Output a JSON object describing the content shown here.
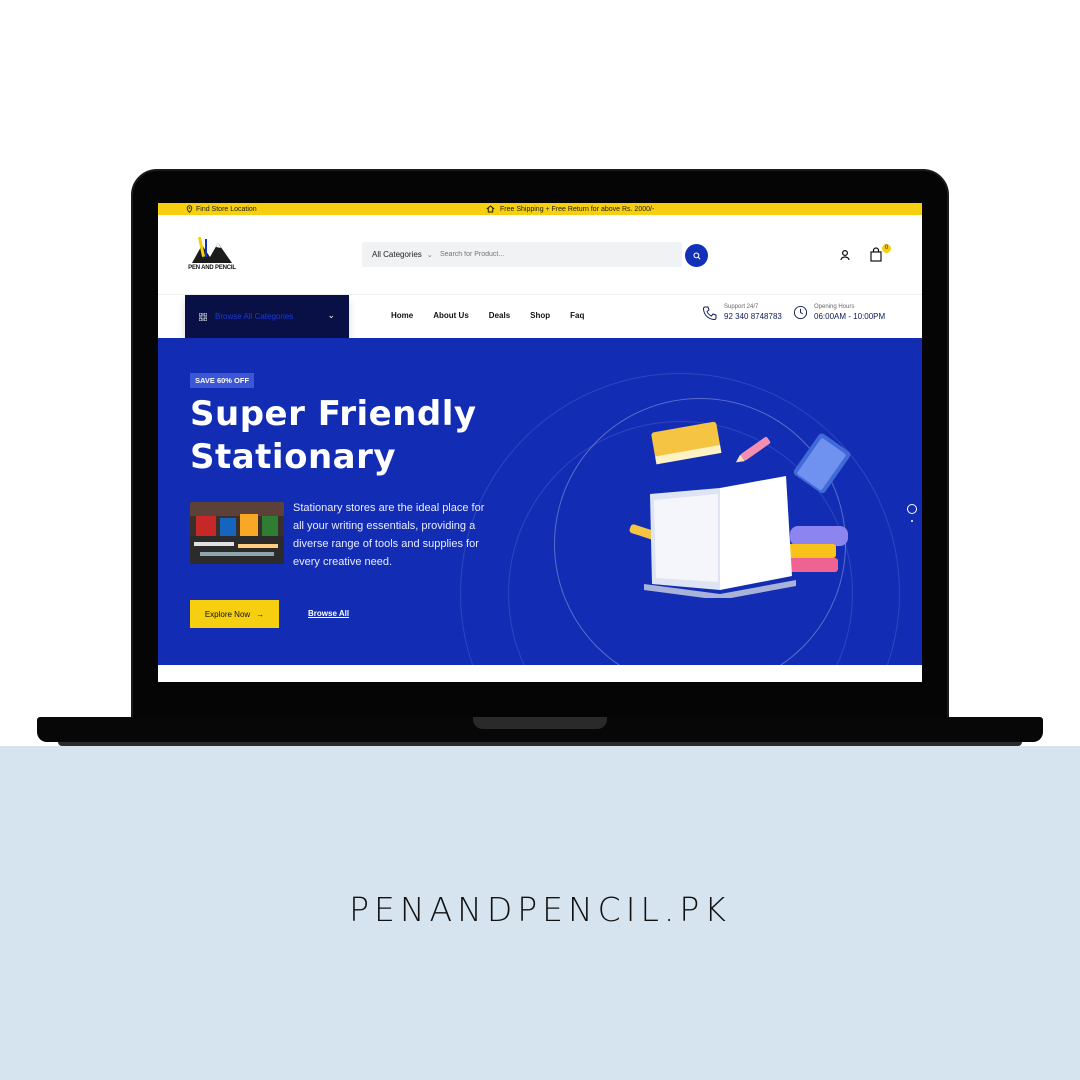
{
  "topbar": {
    "store_location": "Find Store Location",
    "promo": "Free Shipping + Free Return for above Rs. 2000/-"
  },
  "header": {
    "logo_text": "PEN AND PENCIL",
    "category_select": "All Categories",
    "search_placeholder": "Search for Product...",
    "cart_count": "0"
  },
  "nav": {
    "browse_categories": "Browse All Categories",
    "links": [
      "Home",
      "About Us",
      "Deals",
      "Shop",
      "Faq"
    ],
    "support_label": "Support 24/7",
    "support_phone": "92 340 8748783",
    "hours_label": "Opening Hours",
    "hours_value": "06:00AM - 10:00PM"
  },
  "hero": {
    "badge": "SAVE 60% OFF",
    "title": "Super Friendly Stationary",
    "description": "Stationary stores are the ideal place for all your writing essentials, providing a diverse range of tools and supplies for every creative need.",
    "explore_button": "Explore Now",
    "browse_link": "Browse All"
  },
  "footer_domain": "PENANDPENCIL.PK",
  "colors": {
    "accent_yellow": "#f5cf10",
    "hero_blue": "#122db4",
    "nav_dark": "#081045",
    "band": "#d6e4f0"
  }
}
